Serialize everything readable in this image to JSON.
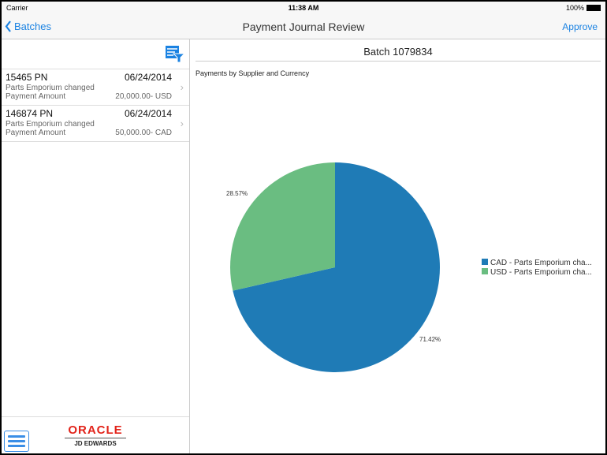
{
  "status": {
    "carrier": "Carrier",
    "time": "11:38 AM",
    "battery": "100%"
  },
  "nav": {
    "back": "Batches",
    "title": "Payment Journal Review",
    "approve": "Approve"
  },
  "list": [
    {
      "id": "15465 PN",
      "date": "06/24/2014",
      "desc": "Parts Emporium changed",
      "label": "Payment Amount",
      "amount": "20,000.00- USD"
    },
    {
      "id": "146874 PN",
      "date": "06/24/2014",
      "desc": "Parts Emporium changed",
      "label": "Payment Amount",
      "amount": "50,000.00- CAD"
    }
  ],
  "logo": {
    "oracle": "ORACLE",
    "jde": "JD EDWARDS"
  },
  "detail": {
    "batch": "Batch 1079834"
  },
  "chart_data": {
    "type": "pie",
    "title": "Payments by Supplier and Currency",
    "slices": [
      {
        "name": "CAD - Parts Emporium cha...",
        "value": 71.42,
        "label": "71.42%",
        "color": "#1f7bb6"
      },
      {
        "name": "USD - Parts Emporium cha...",
        "value": 28.57,
        "label": "28.57%",
        "color": "#6abd81"
      }
    ],
    "legend": "right"
  }
}
